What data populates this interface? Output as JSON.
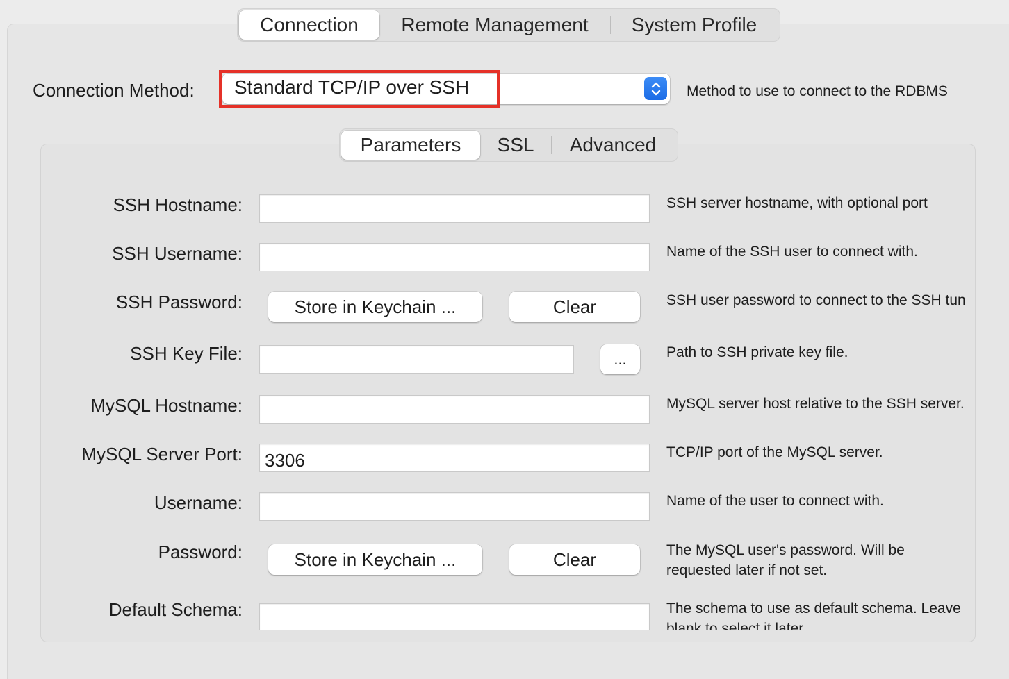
{
  "tabs": {
    "items": [
      {
        "label": "Connection",
        "active": true
      },
      {
        "label": "Remote Management",
        "active": false
      },
      {
        "label": "System Profile",
        "active": false
      }
    ]
  },
  "connection_method": {
    "label": "Connection Method:",
    "value": "Standard TCP/IP over SSH",
    "description": "Method to use to connect to the RDBMS"
  },
  "subtabs": {
    "items": [
      {
        "label": "Parameters",
        "active": true
      },
      {
        "label": "SSL",
        "active": false
      },
      {
        "label": "Advanced",
        "active": false
      }
    ]
  },
  "params": {
    "ssh_hostname": {
      "label": "SSH Hostname:",
      "value": "",
      "description": "SSH server hostname, with  optional port"
    },
    "ssh_username": {
      "label": "SSH Username:",
      "value": "",
      "description": "Name of the SSH user to connect with."
    },
    "ssh_password": {
      "label": "SSH Password:",
      "store_label": "Store in Keychain ...",
      "clear_label": "Clear",
      "description": "SSH user password to connect to the SSH tunnel."
    },
    "ssh_key_file": {
      "label": "SSH Key File:",
      "value": "",
      "browse_label": "...",
      "description": "Path to SSH private key file."
    },
    "mysql_hostname": {
      "label": "MySQL Hostname:",
      "value": "",
      "description": "MySQL server host relative to the SSH server."
    },
    "mysql_port": {
      "label": "MySQL Server Port:",
      "value": "3306",
      "description": "TCP/IP port of the MySQL server."
    },
    "username": {
      "label": "Username:",
      "value": "",
      "description": "Name of the user to connect with."
    },
    "password": {
      "label": "Password:",
      "store_label": "Store in Keychain ...",
      "clear_label": "Clear",
      "description": "The MySQL user's password. Will be requested later if not set."
    },
    "default_schema": {
      "label": "Default Schema:",
      "value": "",
      "description": "The schema to use as default schema. Leave blank to select it later."
    }
  },
  "colors": {
    "accent": "#1c6ce6",
    "highlight": "#e53128"
  }
}
